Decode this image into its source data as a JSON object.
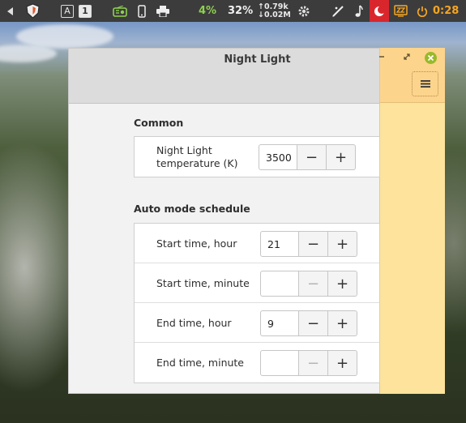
{
  "panel": {
    "keyboard_layout": "A",
    "workspace": "1",
    "battery_pct": "4%",
    "cpu_pct": "32%",
    "net_up": "↑0.79k",
    "net_down": "↓0.02M",
    "clock": "0:28",
    "icons": [
      "left-arrow-icon",
      "shield-icon",
      "radio-icon",
      "phone-icon",
      "printer-icon",
      "gear-icon",
      "pen-icon",
      "music-note-icon",
      "moon-icon",
      "sleep-icon",
      "power-icon"
    ]
  },
  "window": {
    "title": "Night Light",
    "sections": [
      {
        "title": "Common",
        "rows": [
          {
            "label": "Night Light temperature (K)",
            "value": "3500",
            "minus": "−",
            "plus": "+",
            "minus_enabled": true
          }
        ]
      },
      {
        "title": "Auto mode schedule",
        "rows": [
          {
            "label": "Start time, hour",
            "value": "21",
            "minus": "−",
            "plus": "+",
            "minus_enabled": true
          },
          {
            "label": "Start time, minute",
            "value": "",
            "minus": "−",
            "plus": "+",
            "minus_enabled": false
          },
          {
            "label": "End time, hour",
            "value": "9",
            "minus": "−",
            "plus": "+",
            "minus_enabled": true
          },
          {
            "label": "End time, minute",
            "value": "",
            "minus": "−",
            "plus": "+",
            "minus_enabled": false
          }
        ]
      }
    ]
  },
  "colors": {
    "panel_bg": "#3c3c3c",
    "night_tint": "#fde39b",
    "battery_green": "#8fd14f",
    "clock_orange": "#f5a623",
    "close_green": "#9ab82b"
  }
}
